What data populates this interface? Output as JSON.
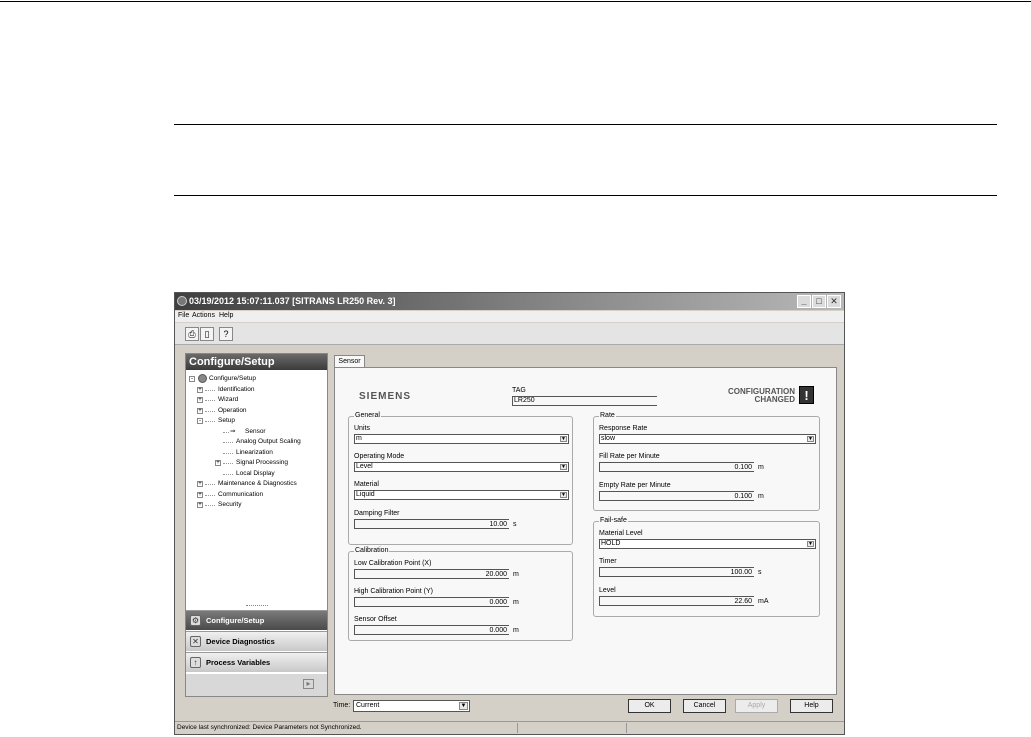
{
  "window": {
    "title": "03/19/2012 15:07:11.037 [SITRANS LR250 Rev. 3]"
  },
  "menu": [
    "File",
    "Actions",
    "Help"
  ],
  "toolbar": [
    "print-icon",
    "preview-icon",
    "context-help-icon"
  ],
  "nav": {
    "header": "Configure/Setup",
    "tree": [
      {
        "label": "Configure/Setup",
        "level": 0,
        "expander": "-"
      },
      {
        "label": "Identification",
        "level": 1,
        "expander": "+"
      },
      {
        "label": "Wizard",
        "level": 1,
        "expander": "+"
      },
      {
        "label": "Operation",
        "level": 1,
        "expander": "+"
      },
      {
        "label": "Setup",
        "level": 1,
        "expander": "-"
      },
      {
        "label": "Sensor",
        "level": 2,
        "expander": "",
        "selected": true
      },
      {
        "label": "Analog Output Scaling",
        "level": 2,
        "expander": ""
      },
      {
        "label": "Linearization",
        "level": 2,
        "expander": ""
      },
      {
        "label": "Signal Processing",
        "level": 2,
        "expander": "+"
      },
      {
        "label": "Local Display",
        "level": 2,
        "expander": ""
      },
      {
        "label": "Maintenance & Diagnostics",
        "level": 1,
        "expander": "+"
      },
      {
        "label": "Communication",
        "level": 1,
        "expander": "+"
      },
      {
        "label": "Security",
        "level": 1,
        "expander": "+"
      }
    ],
    "sections": [
      "Configure/Setup",
      "Device Diagnostics",
      "Process Variables"
    ]
  },
  "tab": "Sensor",
  "header": {
    "logo": "SIEMENS",
    "tag_label": "TAG",
    "tag_value": "LR250",
    "config_line1": "CONFIGURATION",
    "config_line2": "CHANGED",
    "config_icon": "!"
  },
  "general": {
    "title": "General",
    "units_label": "Units",
    "units_value": "m",
    "mode_label": "Operating Mode",
    "mode_value": "Level",
    "material_label": "Material",
    "material_value": "Liquid",
    "damping_label": "Damping Filter",
    "damping_value": "10.00",
    "damping_unit": "s"
  },
  "calibration": {
    "title": "Calibration",
    "low_label": "Low Calibration Point (X)",
    "low_value": "20.000",
    "low_unit": "m",
    "high_label": "High Calibration Point (Y)",
    "high_value": "0.000",
    "high_unit": "m",
    "offset_label": "Sensor Offset",
    "offset_value": "0.000",
    "offset_unit": "m"
  },
  "rate": {
    "title": "Rate",
    "response_label": "Response Rate",
    "response_value": "slow",
    "fill_label": "Fill Rate per Minute",
    "fill_value": "0.100",
    "fill_unit": "m",
    "empty_label": "Empty Rate per Minute",
    "empty_value": "0.100",
    "empty_unit": "m"
  },
  "failsafe": {
    "title": "Fail-safe",
    "material_label": "Material Level",
    "material_value": "HOLD",
    "timer_label": "Timer",
    "timer_value": "100.00",
    "timer_unit": "s",
    "level_label": "Level",
    "level_value": "22.60",
    "level_unit": "mA"
  },
  "bottom": {
    "time_label": "Time:",
    "time_value": "Current",
    "ok": "OK",
    "cancel": "Cancel",
    "apply": "Apply",
    "help": "Help"
  },
  "status": "Device last synchronized: Device Parameters not Synchronized."
}
